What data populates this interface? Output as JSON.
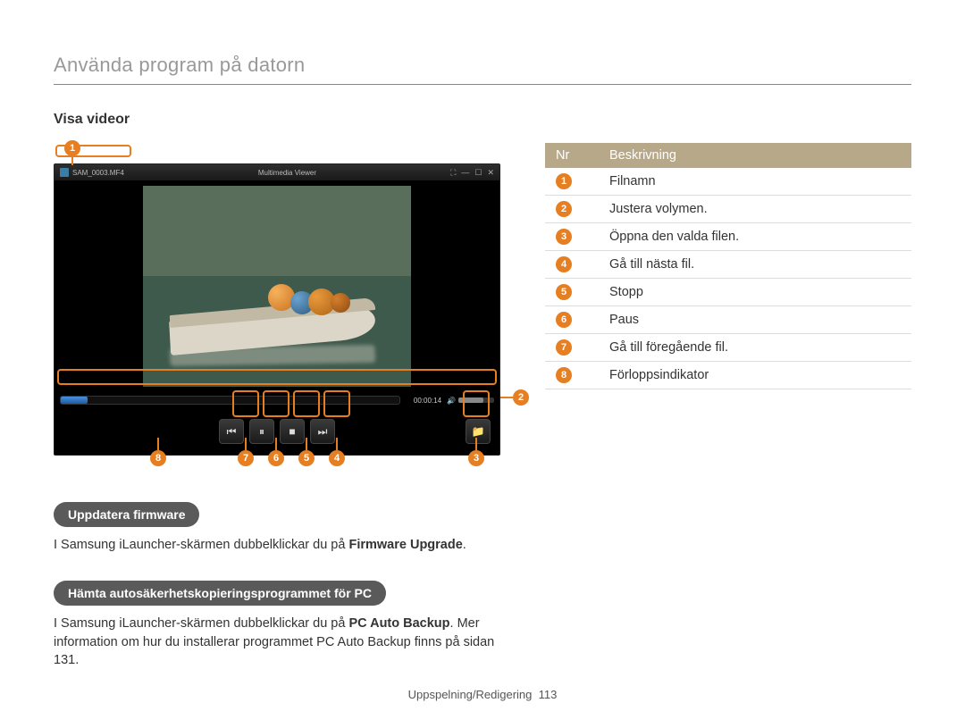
{
  "section_header": "Använda program på datorn",
  "subheading": "Visa videor",
  "viewer": {
    "titlebar_filename": "SAM_0003.MF4",
    "titlebar_app": "Multimedia Viewer",
    "time": "00:00:14"
  },
  "callouts": {
    "n1": "1",
    "n2": "2",
    "n3": "3",
    "n4": "4",
    "n5": "5",
    "n6": "6",
    "n7": "7",
    "n8": "8"
  },
  "table": {
    "headers": {
      "nr": "Nr",
      "desc": "Beskrivning"
    },
    "rows": [
      {
        "n": "1",
        "text": "Filnamn"
      },
      {
        "n": "2",
        "text": "Justera volymen."
      },
      {
        "n": "3",
        "text": "Öppna den valda filen."
      },
      {
        "n": "4",
        "text": "Gå till nästa fil."
      },
      {
        "n": "5",
        "text": "Stopp"
      },
      {
        "n": "6",
        "text": "Paus"
      },
      {
        "n": "7",
        "text": "Gå till föregående fil."
      },
      {
        "n": "8",
        "text": "Förloppsindikator"
      }
    ]
  },
  "pill1": "Uppdatera firmware",
  "para1_a": "I Samsung iLauncher-skärmen dubbelklickar du på ",
  "para1_b": "Firmware Upgrade",
  "para1_c": ".",
  "pill2": "Hämta autosäkerhetskopieringsprogrammet för PC",
  "para2_a": "I Samsung iLauncher-skärmen dubbelklickar du på ",
  "para2_b": "PC Auto Backup",
  "para2_c": ". Mer information om hur du installerar programmet PC Auto Backup finns på sidan 131.",
  "footer": {
    "label": "Uppspelning/Redigering",
    "page": "113"
  }
}
